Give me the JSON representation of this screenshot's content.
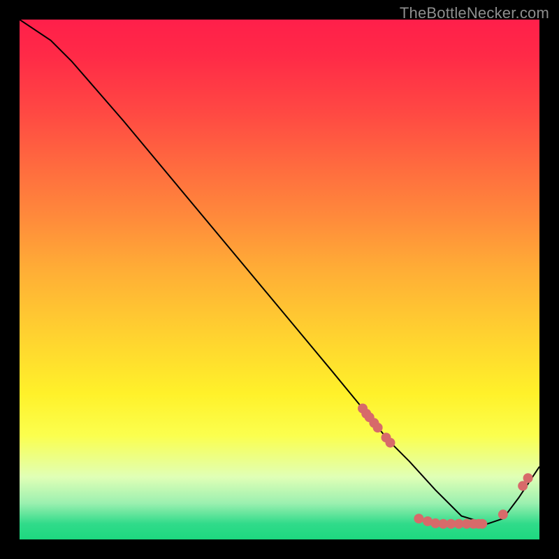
{
  "source_label": "TheBottleNecker.com",
  "colors": {
    "dot_fill": "#d76a6a",
    "curve_stroke": "#000000",
    "page_bg": "#000000",
    "source_text": "#8e8e8e"
  },
  "chart_data": {
    "type": "line",
    "title": "",
    "xlabel": "",
    "ylabel": "",
    "xlim": [
      0,
      100
    ],
    "ylim": [
      0,
      100
    ],
    "grid": false,
    "legend": false,
    "series": [
      {
        "name": "bottleneck-curve",
        "x": [
          0,
          6,
          10,
          20,
          30,
          40,
          50,
          60,
          66,
          71,
          75,
          80,
          85,
          90,
          93,
          96,
          100
        ],
        "values": [
          100,
          96,
          92,
          80.5,
          68.5,
          56.5,
          44.5,
          32.5,
          25.2,
          19,
          15,
          9.5,
          4.5,
          3,
          4,
          8,
          14
        ]
      }
    ],
    "markers": [
      {
        "x": 66.0,
        "y": 25.2
      },
      {
        "x": 66.7,
        "y": 24.2
      },
      {
        "x": 67.3,
        "y": 23.5
      },
      {
        "x": 68.2,
        "y": 22.4
      },
      {
        "x": 68.9,
        "y": 21.5
      },
      {
        "x": 70.5,
        "y": 19.6
      },
      {
        "x": 71.3,
        "y": 18.6
      },
      {
        "x": 76.8,
        "y": 4.0
      },
      {
        "x": 78.5,
        "y": 3.5
      },
      {
        "x": 80.0,
        "y": 3.1
      },
      {
        "x": 81.5,
        "y": 3.0
      },
      {
        "x": 83.0,
        "y": 3.0
      },
      {
        "x": 84.5,
        "y": 3.0
      },
      {
        "x": 86.0,
        "y": 3.0
      },
      {
        "x": 87.3,
        "y": 3.0
      },
      {
        "x": 88.3,
        "y": 3.0
      },
      {
        "x": 89.0,
        "y": 3.0
      },
      {
        "x": 93.0,
        "y": 4.8
      },
      {
        "x": 96.8,
        "y": 10.3
      },
      {
        "x": 97.8,
        "y": 11.8
      }
    ]
  }
}
